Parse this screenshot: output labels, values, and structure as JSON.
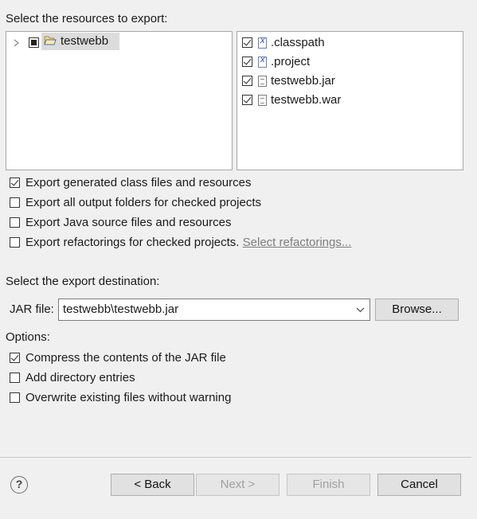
{
  "resources_label": "Select the resources to export:",
  "tree": {
    "project_label": "testwebb"
  },
  "files": [
    {
      "label": ".classpath",
      "icon": "xml-file-icon"
    },
    {
      "label": ".project",
      "icon": "xml-file-icon"
    },
    {
      "label": "testwebb.jar",
      "icon": "text-file-icon"
    },
    {
      "label": "testwebb.war",
      "icon": "text-file-icon"
    }
  ],
  "export_options": [
    {
      "label": "Export generated class files and resources"
    },
    {
      "label": "Export all output folders for checked projects"
    },
    {
      "label": "Export Java source files and resources"
    },
    {
      "label": "Export refactorings for checked projects.",
      "link": "Select refactorings..."
    }
  ],
  "destination_label": "Select the export destination:",
  "jar_field": {
    "label": "JAR file:",
    "value": "testwebb\\testwebb.jar",
    "browse_label": "Browse..."
  },
  "options_label": "Options:",
  "options": [
    {
      "label": "Compress the contents of the JAR file"
    },
    {
      "label": "Add directory entries"
    },
    {
      "label": "Overwrite existing files without warning"
    }
  ],
  "buttons": {
    "help": "?",
    "back": "< Back",
    "next": "Next >",
    "finish": "Finish",
    "cancel": "Cancel"
  }
}
